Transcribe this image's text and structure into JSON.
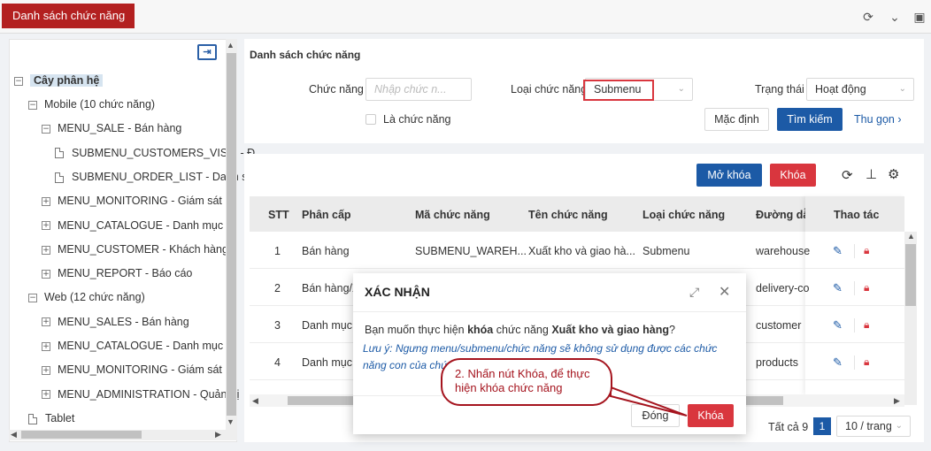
{
  "app": {
    "tab_title": "Danh sách chức năng"
  },
  "tree": {
    "root": "Cây phân hệ",
    "items": [
      {
        "label": "Mobile (10 chức năng)",
        "type": "minus"
      },
      {
        "label": "MENU_SALE - Bán hàng",
        "type": "minus"
      },
      {
        "label": "SUBMENU_CUSTOMERS_VISIT - Đ",
        "type": "file"
      },
      {
        "label": "SUBMENU_ORDER_LIST - Danh s",
        "type": "file"
      },
      {
        "label": "MENU_MONITORING - Giám sát",
        "type": "plus"
      },
      {
        "label": "MENU_CATALOGUE - Danh mục",
        "type": "plus"
      },
      {
        "label": "MENU_CUSTOMER - Khách hàng",
        "type": "plus"
      },
      {
        "label": "MENU_REPORT - Báo cáo",
        "type": "plus"
      },
      {
        "label": "Web (12 chức năng)",
        "type": "minus"
      },
      {
        "label": "MENU_SALES - Bán hàng",
        "type": "plus"
      },
      {
        "label": "MENU_CATALOGUE - Danh mục",
        "type": "plus"
      },
      {
        "label": "MENU_MONITORING - Giám sát",
        "type": "plus"
      },
      {
        "label": "MENU_ADMINISTRATION - Quản trị",
        "type": "plus"
      },
      {
        "label": "Tablet",
        "type": "file"
      }
    ]
  },
  "filter": {
    "section_title": "Danh sách chức năng",
    "function_label": "Chức năng",
    "function_placeholder": "Nhập chức n...",
    "type_label": "Loại chức năng",
    "type_value": "Submenu",
    "status_label": "Trạng thái",
    "status_value": "Hoạt động",
    "is_function_label": "Là chức năng",
    "default_button": "Mặc định",
    "search_button": "Tìm kiếm",
    "collapse_link": "Thu gọn"
  },
  "toolbar": {
    "unlock_button": "Mở khóa",
    "lock_button": "Khóa"
  },
  "table": {
    "columns": [
      "STT",
      "Phân cấp",
      "Mã chức năng",
      "Tên chức năng",
      "Loại chức năng",
      "Đường dẫ",
      "Thao tác"
    ],
    "rows": [
      {
        "stt": "1",
        "level": "Bán hàng",
        "code": "SUBMENU_WAREH...",
        "name": "Xuất kho và giao hà...",
        "type": "Submenu",
        "path": "warehouse"
      },
      {
        "stt": "2",
        "level": "Bán hàng/X",
        "code": "",
        "name": "",
        "type": "",
        "path": "delivery-co"
      },
      {
        "stt": "3",
        "level": "Danh mục",
        "code": "",
        "name": "",
        "type": "",
        "path": "customer"
      },
      {
        "stt": "4",
        "level": "Danh mục",
        "code": "",
        "name": "",
        "type": "",
        "path": "products"
      }
    ]
  },
  "pagination": {
    "total": "Tất cả 9",
    "page": "1",
    "page_size": "10 / trang"
  },
  "modal": {
    "title": "XÁC NHẬN",
    "body_prefix": "Bạn muốn thực hiện ",
    "body_action": "khóa",
    "body_mid": " chức năng ",
    "body_name": "Xuất kho và giao hàng",
    "body_suffix": "?",
    "note": "Lưu ý: Ngưng menu/submenu/chức năng sẽ không sử dụng được các chức năng con của chức",
    "close_button": "Đóng",
    "lock_button": "Khóa"
  },
  "annotation": {
    "callout": "2. Nhấn nút Khóa, để thực hiện khóa chức năng"
  },
  "colors": {
    "brand_red": "#b32020",
    "primary_blue": "#1c5aa6",
    "danger_red": "#d9363e"
  }
}
